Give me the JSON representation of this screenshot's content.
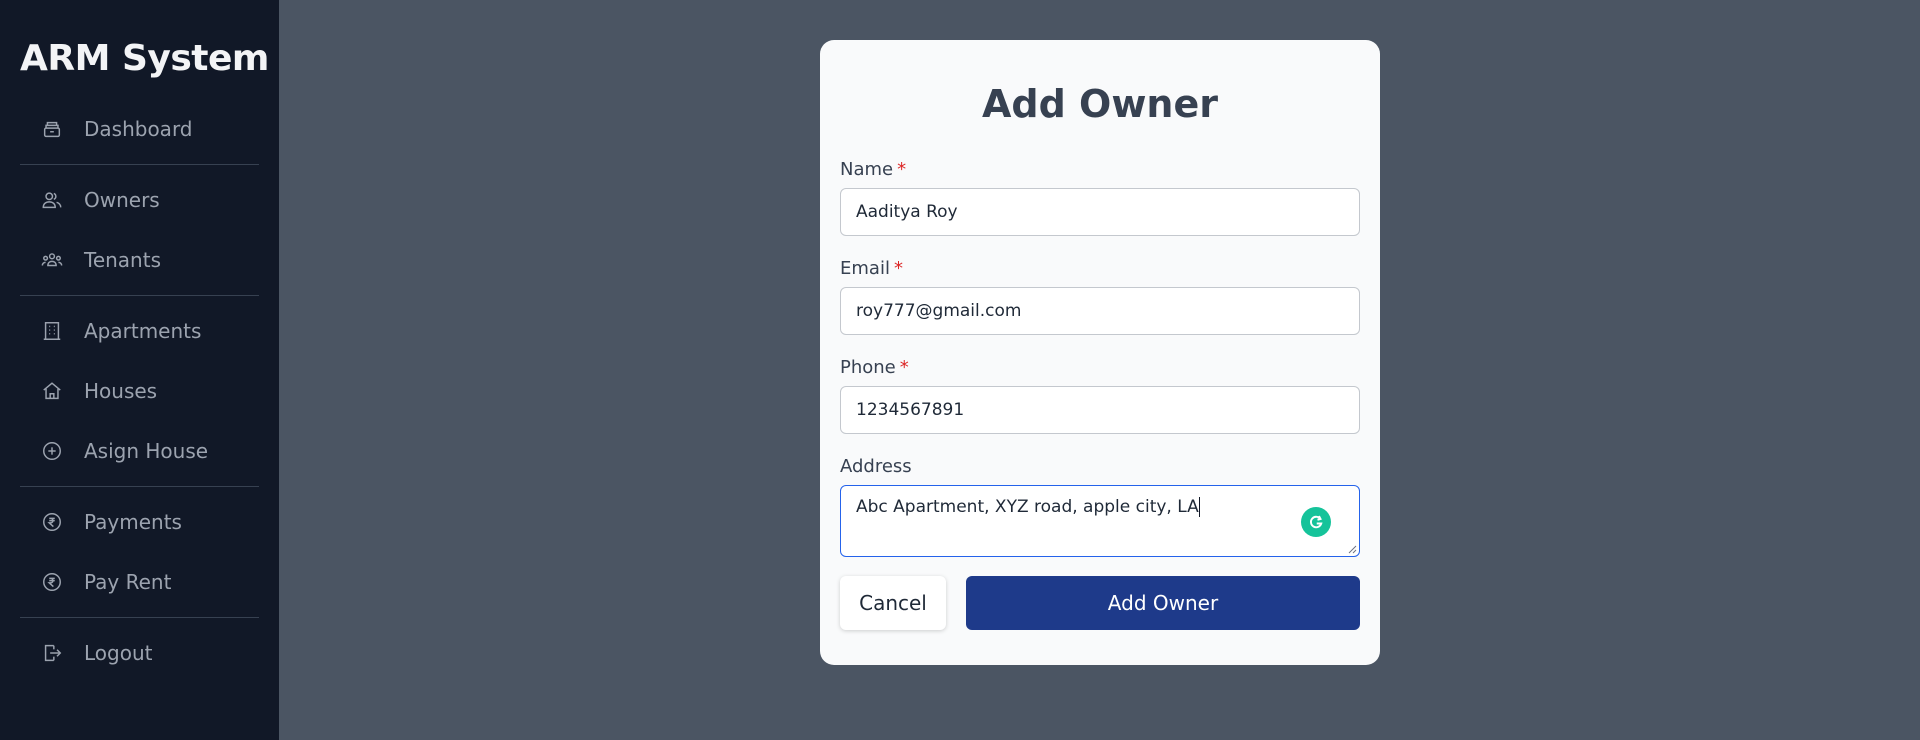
{
  "app": {
    "title": "ARM System"
  },
  "sidebar": {
    "items": [
      {
        "label": "Dashboard",
        "icon": "drawers-icon"
      },
      {
        "label": "Owners",
        "icon": "users-icon"
      },
      {
        "label": "Tenants",
        "icon": "user-group-icon"
      },
      {
        "label": "Apartments",
        "icon": "building-icon"
      },
      {
        "label": "Houses",
        "icon": "home-icon"
      },
      {
        "label": "Asign House",
        "icon": "plus-circle-icon"
      },
      {
        "label": "Payments",
        "icon": "rupee-circle-icon"
      },
      {
        "label": "Pay Rent",
        "icon": "rupee-circle-icon"
      },
      {
        "label": "Logout",
        "icon": "logout-icon"
      }
    ]
  },
  "modal": {
    "title": "Add Owner",
    "fields": {
      "name": {
        "label": "Name",
        "required_mark": "*",
        "value": "Aaditya Roy"
      },
      "email": {
        "label": "Email",
        "required_mark": "*",
        "value": "roy777@gmail.com"
      },
      "phone": {
        "label": "Phone",
        "required_mark": "*",
        "value": "1234567891"
      },
      "address": {
        "label": "Address",
        "value": "Abc Apartment, XYZ road, apple city, LA"
      }
    },
    "cancel_label": "Cancel",
    "submit_label": "Add Owner"
  },
  "colors": {
    "sidebar_bg": "#111827",
    "page_bg": "#4b5563",
    "primary": "#1e3a8a",
    "required": "#dc2626",
    "grammarly": "#15c39a"
  }
}
